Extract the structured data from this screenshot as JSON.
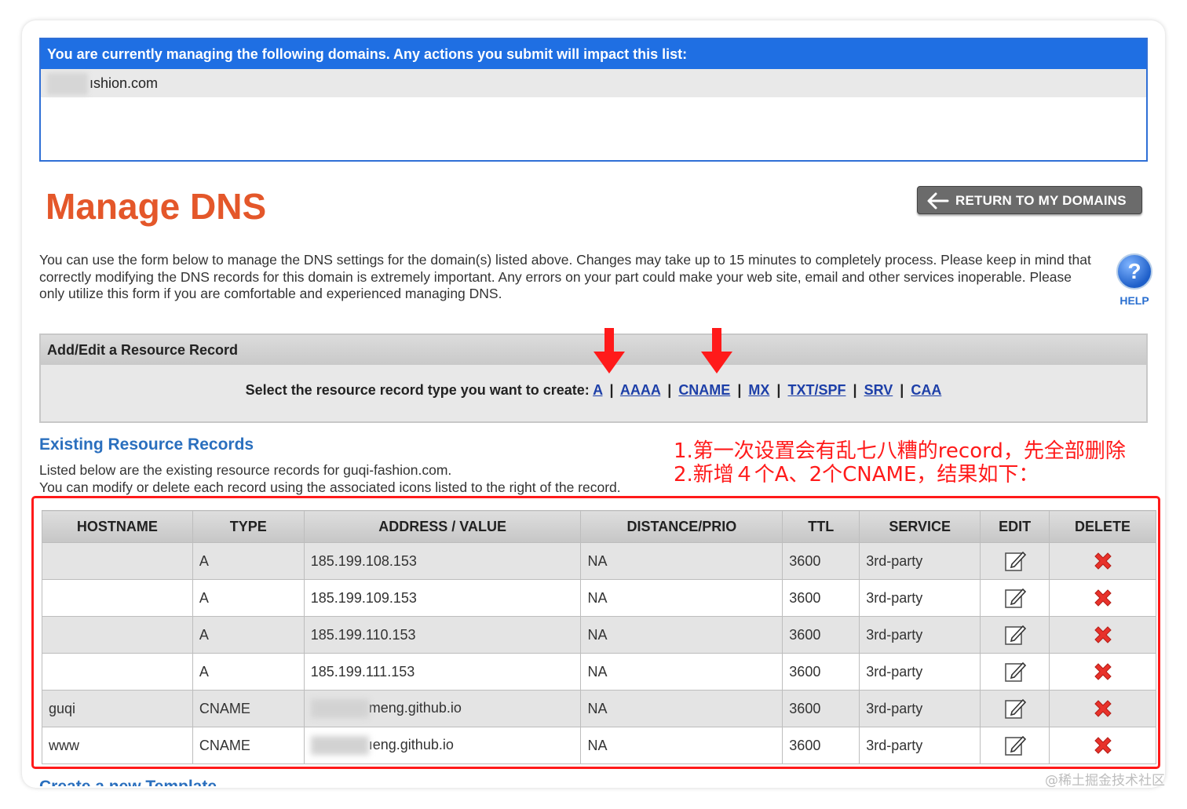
{
  "managing": {
    "header": "You are currently managing the following domains. Any actions you submit will impact this list:",
    "domain_visible": "ıshion.com"
  },
  "page_title": "Manage DNS",
  "return_button": "RETURN TO MY DOMAINS",
  "intro": "You can use the form below to manage the DNS settings for the domain(s) listed above. Changes may take up to 15 minutes to completely process. Please keep in mind that correctly modifying the DNS records for this domain is extremely important. Any errors on your part could make your web site, email and other services inoperable. Please only utilize this form if you are comfortable and experienced managing DNS.",
  "help_label": "HELP",
  "add_record": {
    "header": "Add/Edit a Resource Record",
    "prompt": "Select the resource record type you want to create:",
    "types": [
      "A",
      "AAAA",
      "CNAME",
      "MX",
      "TXT/SPF",
      "SRV",
      "CAA"
    ]
  },
  "existing": {
    "title": "Existing Resource Records",
    "line1": "Listed below are the existing resource records for guqi-fashion.com.",
    "line2": "You can modify or delete each record using the associated icons listed to the right of the record."
  },
  "annotation": {
    "line1": "1.第一次设置会有乱七八糟的record，先全部删除",
    "line2": "2.新增４个A、2个CNAME，结果如下："
  },
  "table": {
    "headers": [
      "HOSTNAME",
      "TYPE",
      "ADDRESS / VALUE",
      "DISTANCE/PRIO",
      "TTL",
      "SERVICE",
      "EDIT",
      "DELETE"
    ],
    "rows": [
      {
        "hostname": "",
        "type": "A",
        "value": "185.199.108.153",
        "prio": "NA",
        "ttl": "3600",
        "service": "3rd-party"
      },
      {
        "hostname": "",
        "type": "A",
        "value": "185.199.109.153",
        "prio": "NA",
        "ttl": "3600",
        "service": "3rd-party"
      },
      {
        "hostname": "",
        "type": "A",
        "value": "185.199.110.153",
        "prio": "NA",
        "ttl": "3600",
        "service": "3rd-party"
      },
      {
        "hostname": "",
        "type": "A",
        "value": "185.199.111.153",
        "prio": "NA",
        "ttl": "3600",
        "service": "3rd-party"
      },
      {
        "hostname": "guqi",
        "type": "CNAME",
        "value": "meng.github.io",
        "prio": "NA",
        "ttl": "3600",
        "service": "3rd-party"
      },
      {
        "hostname": "www",
        "type": "CNAME",
        "value": "ıeng.github.io",
        "prio": "NA",
        "ttl": "3600",
        "service": "3rd-party"
      }
    ]
  },
  "create_template": "Create a new Template",
  "watermark": "@稀土掘金技术社区",
  "colors": {
    "title_orange": "#e4572a",
    "header_blue": "#1f6fe3",
    "link_blue": "#1d3fa8",
    "section_blue": "#2a6fbe",
    "annotation_red": "#ff1a1a"
  }
}
